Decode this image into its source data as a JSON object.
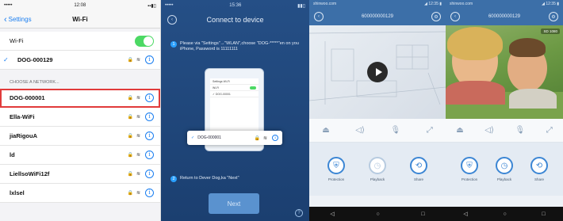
{
  "panel1": {
    "status": {
      "carrier": "•••••",
      "time": "12:08",
      "battery": "▪▪▮▯"
    },
    "nav": {
      "back_label": "Settings",
      "title": "Wi-Fi"
    },
    "wifi_row_label": "Wi-Fi",
    "connected_network": "DOG-000129",
    "section_label": "CHOOSE A NETWORK...",
    "networks": [
      {
        "name": "DOG-000001",
        "highlighted": true
      },
      {
        "name": "Ella-WiFi"
      },
      {
        "name": "jiaRigouA"
      },
      {
        "name": "ld"
      },
      {
        "name": "LiellsoWiFi12f"
      },
      {
        "name": "lxlsel"
      }
    ],
    "info_glyph": "i",
    "lock_wifi_glyph": "🔒 ≋"
  },
  "panel2": {
    "status": {
      "left": "•••••",
      "time": "15:36",
      "right": "▮▮▯"
    },
    "title": "Connect to device",
    "step1_number": "1",
    "step1_text": "Please via \"Settings\"→\"WLAN\",choose \"DOG-*****\"en on you iPhone, Password is 11111111",
    "phone_screen": {
      "header": "Settings     Wi-Fi",
      "wifi_label": "Wi-Fi",
      "connected": "✓ DOG-00001"
    },
    "zoom_check": "✓",
    "zoom_network": "DOG-000001",
    "step2_number": "2",
    "step2_text": "Return to Dever Dog,ka \"Next\"",
    "next_label": "Next",
    "help_glyph": "?"
  },
  "panel3": {
    "status": {
      "left": "shinwoo.com",
      "right": "◢ 12:35 ▮"
    },
    "title": "600000000129",
    "controls": [
      "⏏",
      "◁⟩",
      "🎙",
      "⤢"
    ],
    "actions": [
      {
        "label": "Protection",
        "glyph": "⛨"
      },
      {
        "label": "Playback",
        "glyph": "◷"
      },
      {
        "label": "Share",
        "glyph": "⟲"
      }
    ],
    "android_nav": [
      "◁",
      "○",
      "□"
    ]
  },
  "panel4": {
    "status": {
      "left": "shinwoo.com",
      "right": "◢ 12:35 ▮"
    },
    "title": "600000000129",
    "hd_badge": "SD 1080",
    "controls": [
      "⏏",
      "◁⟩",
      "🎙",
      "⤢"
    ],
    "actions": [
      {
        "label": "Protection",
        "glyph": "⛨"
      },
      {
        "label": "Playback",
        "glyph": "◷"
      },
      {
        "label": "Share",
        "glyph": "⟲"
      }
    ],
    "android_nav": [
      "◁",
      "○",
      "□"
    ]
  },
  "colors": {
    "ios_blue": "#1a7ef0",
    "toggle_green": "#4cd964",
    "highlight_red": "#e13b3b",
    "app_blue": "#3c6fa8"
  }
}
